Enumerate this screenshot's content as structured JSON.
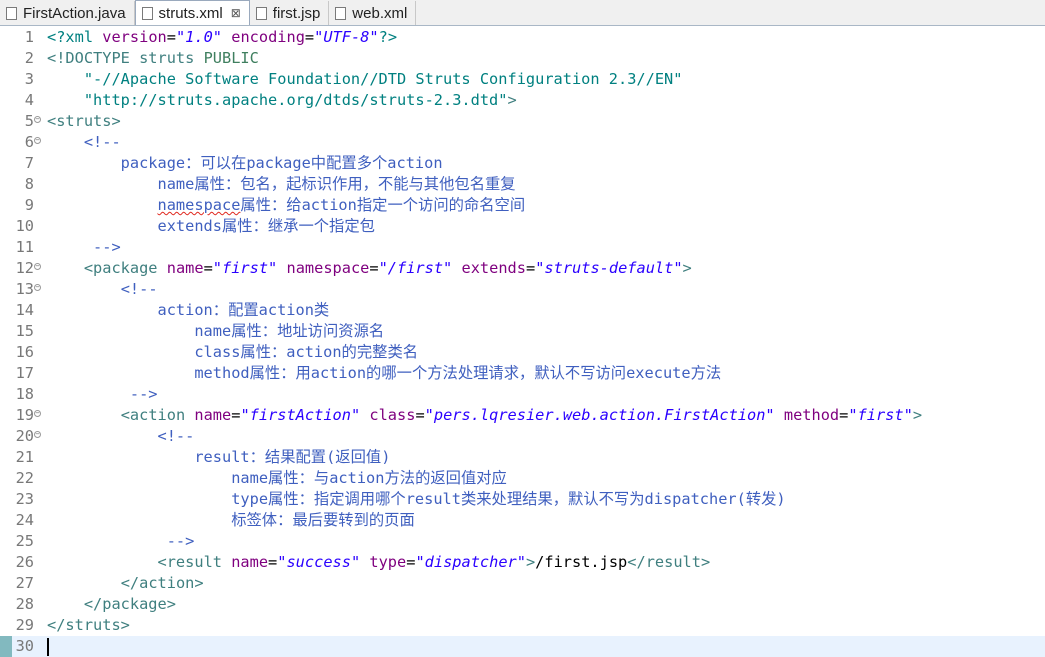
{
  "tabs": [
    {
      "label": "FirstAction.java",
      "icon": "java-file-icon",
      "active": false
    },
    {
      "label": "struts.xml",
      "icon": "xml-file-icon",
      "active": true
    },
    {
      "label": "first.jsp",
      "icon": "jsp-file-icon",
      "active": false
    },
    {
      "label": "web.xml",
      "icon": "xml-file-icon",
      "active": false
    }
  ],
  "close_glyph": "⊠",
  "lines": [
    {
      "n": "1",
      "segs": [
        [
          "pi",
          "<?xml "
        ],
        [
          "attr",
          "version"
        ],
        [
          "text",
          "="
        ],
        [
          "val",
          "\"1.0\""
        ],
        [
          "text",
          " "
        ],
        [
          "attr",
          "encoding"
        ],
        [
          "text",
          "="
        ],
        [
          "val",
          "\"UTF-8\""
        ],
        [
          "pi",
          "?>"
        ]
      ]
    },
    {
      "n": "2",
      "segs": [
        [
          "tag",
          "<!DOCTYPE struts "
        ],
        [
          "dtdv",
          "PUBLIC"
        ]
      ]
    },
    {
      "n": "3",
      "segs": [
        [
          "text",
          "    "
        ],
        [
          "pi",
          "\"-//Apache Software Foundation//DTD Struts Configuration 2.3//EN\""
        ]
      ]
    },
    {
      "n": "4",
      "segs": [
        [
          "text",
          "    "
        ],
        [
          "pi",
          "\"http://struts.apache.org/dtds/struts-2.3.dtd\""
        ],
        [
          "tag",
          ">"
        ]
      ]
    },
    {
      "n": "5",
      "fold": true,
      "segs": [
        [
          "tag",
          "<struts>"
        ]
      ]
    },
    {
      "n": "6",
      "fold": true,
      "segs": [
        [
          "text",
          "    "
        ],
        [
          "com",
          "<!--"
        ]
      ]
    },
    {
      "n": "7",
      "segs": [
        [
          "com",
          "        package：可以在package中配置多个action"
        ]
      ]
    },
    {
      "n": "8",
      "segs": [
        [
          "com",
          "            name属性：包名，起标识作用，不能与其他包名重复"
        ]
      ]
    },
    {
      "n": "9",
      "segs": [
        [
          "com",
          "            "
        ],
        [
          "comsq",
          "namespace"
        ],
        [
          "com",
          "属性：给action指定一个访问的命名空间"
        ]
      ]
    },
    {
      "n": "10",
      "segs": [
        [
          "com",
          "            extends属性：继承一个指定包"
        ]
      ]
    },
    {
      "n": "11",
      "segs": [
        [
          "com",
          "     -->"
        ]
      ]
    },
    {
      "n": "12",
      "fold": true,
      "segs": [
        [
          "text",
          "    "
        ],
        [
          "tag",
          "<package "
        ],
        [
          "attr",
          "name"
        ],
        [
          "text",
          "="
        ],
        [
          "val",
          "\"first\""
        ],
        [
          "text",
          " "
        ],
        [
          "attr",
          "namespace"
        ],
        [
          "text",
          "="
        ],
        [
          "val",
          "\"/first\""
        ],
        [
          "text",
          " "
        ],
        [
          "attr",
          "extends"
        ],
        [
          "text",
          "="
        ],
        [
          "val",
          "\"struts-default\""
        ],
        [
          "tag",
          ">"
        ]
      ]
    },
    {
      "n": "13",
      "fold": true,
      "segs": [
        [
          "text",
          "        "
        ],
        [
          "com",
          "<!--"
        ]
      ]
    },
    {
      "n": "14",
      "segs": [
        [
          "com",
          "            action：配置action类"
        ]
      ]
    },
    {
      "n": "15",
      "segs": [
        [
          "com",
          "                name属性：地址访问资源名"
        ]
      ]
    },
    {
      "n": "16",
      "segs": [
        [
          "com",
          "                class属性：action的完整类名"
        ]
      ]
    },
    {
      "n": "17",
      "segs": [
        [
          "com",
          "                method属性：用action的哪一个方法处理请求，默认不写访问execute方法"
        ]
      ]
    },
    {
      "n": "18",
      "segs": [
        [
          "com",
          "         -->"
        ]
      ]
    },
    {
      "n": "19",
      "fold": true,
      "segs": [
        [
          "text",
          "        "
        ],
        [
          "tag",
          "<action "
        ],
        [
          "attr",
          "name"
        ],
        [
          "text",
          "="
        ],
        [
          "val",
          "\"firstAction\""
        ],
        [
          "text",
          " "
        ],
        [
          "attr",
          "class"
        ],
        [
          "text",
          "="
        ],
        [
          "val",
          "\"pers.lqresier.web.action.FirstAction\""
        ],
        [
          "text",
          " "
        ],
        [
          "attr",
          "method"
        ],
        [
          "text",
          "="
        ],
        [
          "val",
          "\"first\""
        ],
        [
          "tag",
          ">"
        ]
      ]
    },
    {
      "n": "20",
      "fold": true,
      "segs": [
        [
          "text",
          "            "
        ],
        [
          "com",
          "<!--"
        ]
      ]
    },
    {
      "n": "21",
      "segs": [
        [
          "com",
          "                result：结果配置(返回值)"
        ]
      ]
    },
    {
      "n": "22",
      "segs": [
        [
          "com",
          "                    name属性：与action方法的返回值对应"
        ]
      ]
    },
    {
      "n": "23",
      "segs": [
        [
          "com",
          "                    type属性：指定调用哪个result类来处理结果，默认不写为dispatcher(转发)"
        ]
      ]
    },
    {
      "n": "24",
      "segs": [
        [
          "com",
          "                    标签体：最后要转到的页面"
        ]
      ]
    },
    {
      "n": "25",
      "segs": [
        [
          "com",
          "             -->"
        ]
      ]
    },
    {
      "n": "26",
      "segs": [
        [
          "text",
          "            "
        ],
        [
          "tag",
          "<result "
        ],
        [
          "attr",
          "name"
        ],
        [
          "text",
          "="
        ],
        [
          "val",
          "\"success\""
        ],
        [
          "text",
          " "
        ],
        [
          "attr",
          "type"
        ],
        [
          "text",
          "="
        ],
        [
          "val",
          "\"dispatcher\""
        ],
        [
          "tag",
          ">"
        ],
        [
          "text",
          "/first.jsp"
        ],
        [
          "tag",
          "</result>"
        ]
      ]
    },
    {
      "n": "27",
      "segs": [
        [
          "text",
          "        "
        ],
        [
          "tag",
          "</action>"
        ]
      ]
    },
    {
      "n": "28",
      "segs": [
        [
          "text",
          "    "
        ],
        [
          "tag",
          "</package>"
        ]
      ]
    },
    {
      "n": "29",
      "segs": [
        [
          "tag",
          "</struts>"
        ]
      ]
    },
    {
      "n": "30",
      "current": true,
      "segs": []
    }
  ]
}
